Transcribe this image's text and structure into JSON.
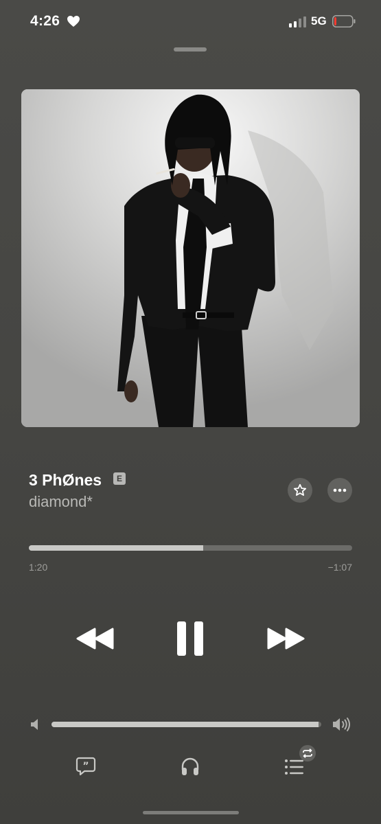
{
  "status_bar": {
    "time": "4:26",
    "network": "5G",
    "battery_level": 0.12
  },
  "now_playing": {
    "track_title": "3 PhØnes",
    "explicit_badge": "E",
    "artist": "diamond*",
    "elapsed": "1:20",
    "remaining": "−1:07",
    "progress": 0.54,
    "volume": 0.99,
    "is_playing": true,
    "repeat_on": true
  },
  "icons": {
    "favorite": "star-icon",
    "more": "ellipsis-icon",
    "rewind": "rewind-icon",
    "pause": "pause-icon",
    "forward": "fast-forward-icon",
    "lyrics": "quote-bubble-icon",
    "airplay": "headphones-icon",
    "queue": "list-icon",
    "repeat": "repeat-icon"
  },
  "colors": {
    "background": "#464643",
    "accent": "#ffffff",
    "secondary_text": "#b9b9b6",
    "battery_low": "#ff3b30"
  }
}
